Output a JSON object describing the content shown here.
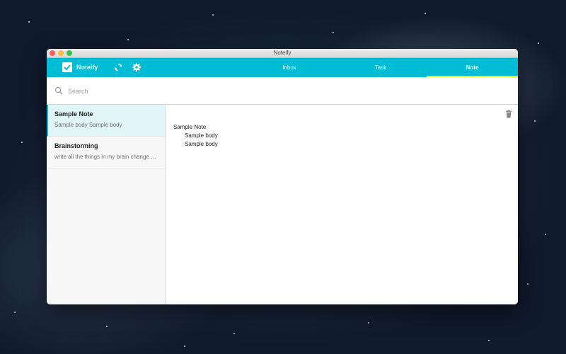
{
  "window": {
    "title": "Noteify"
  },
  "toolbar": {
    "brand_name": "Noteify",
    "icons": {
      "sync": "sync-icon",
      "settings": "gear-icon",
      "brand": "checkbox-icon"
    },
    "tabs": [
      {
        "label": "Inbox",
        "active": false
      },
      {
        "label": "Task",
        "active": false
      },
      {
        "label": "Note",
        "active": true
      }
    ]
  },
  "search": {
    "placeholder": "Search",
    "value": ""
  },
  "notes": [
    {
      "title": "Sample Note",
      "snippet": "Sample body Sample body",
      "selected": true
    },
    {
      "title": "Brainstorming",
      "snippet": "write all the things in my brain change t…",
      "selected": false
    }
  ],
  "editor": {
    "lines": [
      "Sample Note",
      "Sample body",
      "Sample body"
    ]
  },
  "colors": {
    "accent": "#00bcd4",
    "active_tab_underline": "#e4ee3a",
    "selected_item_bg": "#e0f6f8"
  }
}
